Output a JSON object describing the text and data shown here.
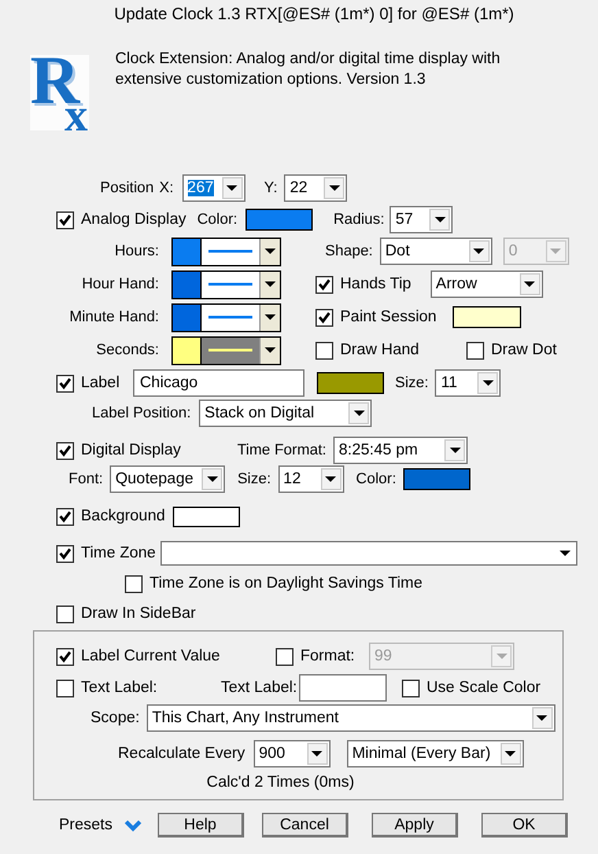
{
  "window": {
    "title": "Update Clock 1.3 RTX[@ES# (1m*) 0] for @ES# (1m*)"
  },
  "header": {
    "logo_big": "R",
    "logo_small": "x",
    "description": "Clock Extension: Analog and/or digital time display with extensive customization options. Version 1.3"
  },
  "position": {
    "label": "Position",
    "x_label": "X:",
    "x_value": "267",
    "x_highlighted": true,
    "y_label": "Y:",
    "y_value": "22"
  },
  "analog": {
    "label": "Analog Display",
    "checked": true,
    "color_label": "Color:",
    "color": "#0a7cf0"
  },
  "radius": {
    "label": "Radius:",
    "value": "57"
  },
  "styles": [
    {
      "label": "Hours:",
      "color": "#0a7cf0",
      "line": {
        "color": "#0a7cf0"
      },
      "line_box": {
        "color": "#ffffff"
      }
    },
    {
      "label": "Hour Hand:",
      "color": "#0066dd",
      "line": {
        "color": "#0a7cf0"
      },
      "line_box": {
        "color": "#ffffff"
      }
    },
    {
      "label": "Minute Hand:",
      "color": "#0066dd",
      "line": {
        "color": "#0a7cf0"
      },
      "line_box": {
        "color": "#ffffff"
      }
    },
    {
      "label": "Seconds:",
      "color": "#ffff80",
      "line": {
        "color": "#ffff80"
      },
      "line_box": {
        "color": "#808080"
      }
    }
  ],
  "shape": {
    "label": "Shape:",
    "value": "Dot",
    "count": "0",
    "count_disabled": true
  },
  "hands_tip": {
    "label": "Hands Tip",
    "checked": true,
    "value": "Arrow"
  },
  "paint_session": {
    "label": "Paint Session",
    "checked": true,
    "color": "#ffffcc"
  },
  "draw_hand": {
    "label": "Draw Hand",
    "checked": false
  },
  "draw_dot": {
    "label": "Draw Dot",
    "checked": false
  },
  "label": {
    "label": "Label",
    "checked": true,
    "value": "Chicago",
    "color": "#999900",
    "size_label": "Size:",
    "size": "11",
    "position_label": "Label Position:",
    "position": "Stack on Digital"
  },
  "digital": {
    "label": "Digital Display",
    "checked": true,
    "format_label": "Time Format:",
    "format": "8:25:45 pm",
    "font_label": "Font:",
    "font": "Quotepage",
    "size_label": "Size:",
    "size": "12",
    "color_label": "Color:",
    "color": "#0066cc"
  },
  "background": {
    "label": "Background",
    "checked": true,
    "color": "#ffffff"
  },
  "time_zone": {
    "label": "Time Zone",
    "checked": true,
    "dst_label": "Time Zone is on Daylight Savings Time",
    "dst_checked": false
  },
  "sidebar": {
    "label": "Draw In SideBar",
    "checked": false
  },
  "value_group": {
    "label_current": {
      "label": "Label Current Value",
      "checked": true
    },
    "format": {
      "label": "Format:",
      "checked": false,
      "value": "99",
      "disabled": true
    },
    "text_label": {
      "label": "Text Label:",
      "checked": false
    },
    "text_label_field_label": "Text Label:",
    "scale_color": {
      "label": "Use Scale Color",
      "checked": false
    },
    "scope_label": "Scope:",
    "scope": "This Chart, Any Instrument",
    "recalc_label": "Recalculate Every",
    "recalc_value": "900",
    "recalc_mode": "Minimal (Every Bar)",
    "calc_info": "Calc'd 2 Times (0ms)"
  },
  "footer": {
    "presets": "Presets",
    "buttons": [
      "Help",
      "Cancel",
      "Apply",
      "OK"
    ]
  }
}
